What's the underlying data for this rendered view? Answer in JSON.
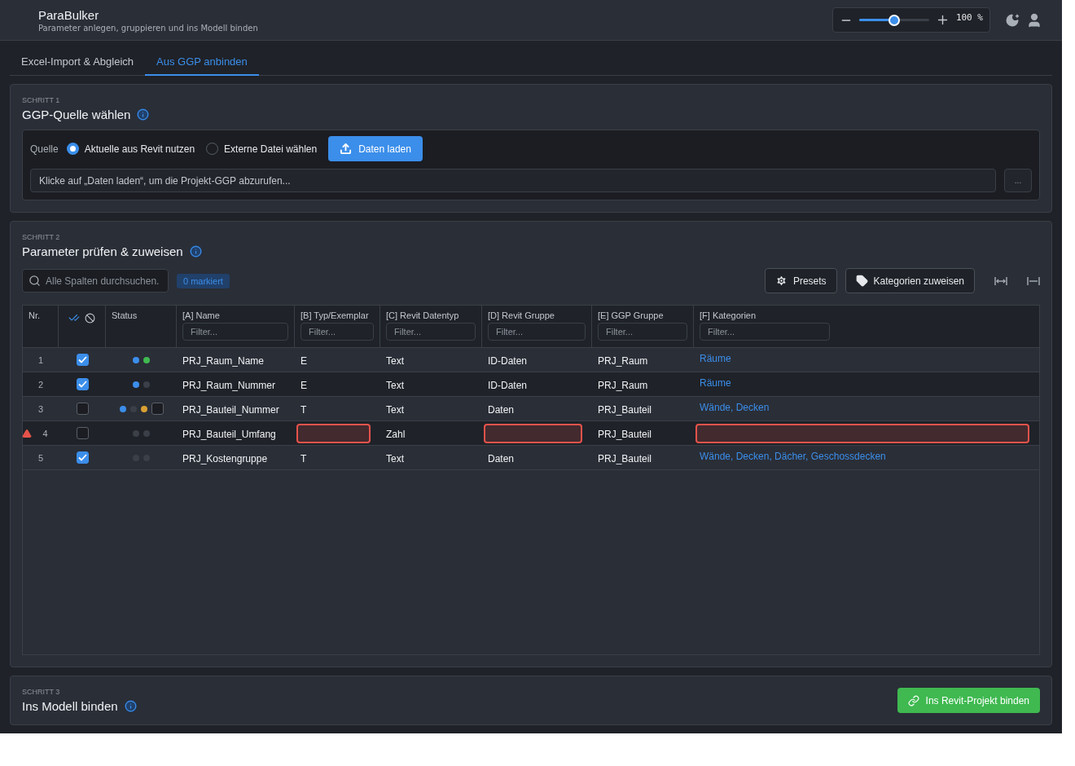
{
  "app": {
    "title": "ParaBulker",
    "subtitle": "Parameter anlegen, gruppieren und ins Modell binden"
  },
  "zoom": {
    "level": 0.5,
    "reading": "100 %"
  },
  "tabs": [
    {
      "label": "Excel-Import & Abgleich",
      "selected": false
    },
    {
      "label": "Aus GGP anbinden",
      "selected": true
    }
  ],
  "step1": {
    "step": "SCHRITT 1",
    "title": "GGP-Quelle wählen",
    "source_label": "Quelle",
    "options": [
      {
        "label": "Aktuelle aus Revit nutzen",
        "selected": true
      },
      {
        "label": "Externe Datei wählen",
        "selected": false
      }
    ],
    "load_button": "Daten laden",
    "path_placeholder": "Klicke auf „Daten laden“, um die Projekt-GGP abzurufen...",
    "browse_button": "..."
  },
  "step2": {
    "step": "SCHRITT 2",
    "title": "Parameter prüfen & zuweisen",
    "search_placeholder": "Alle Spalten durchsuchen.",
    "marked_badge": "0 markiert",
    "presets_button": "Presets",
    "categories_button": "Kategorien zuweisen",
    "table": {
      "nr_header": "Nr.",
      "status_header": "Status",
      "columns": [
        {
          "label": "[A] Name",
          "kind": "text",
          "placeholder": "Filter..."
        },
        {
          "label": "[B] Typ/Exemplar",
          "kind": "text",
          "placeholder": "Filter..."
        },
        {
          "label": "[C] Revit Datentyp",
          "kind": "text",
          "placeholder": "Filter..."
        },
        {
          "label": "[D] Revit Gruppe",
          "kind": "text",
          "placeholder": "Filter..."
        },
        {
          "label": "[E] GGP Gruppe",
          "kind": "text",
          "placeholder": "Filter..."
        },
        {
          "label": "[F] Kategorien",
          "kind": "link",
          "placeholder": "Filter..."
        }
      ],
      "rows": [
        {
          "nr": "1",
          "checked": true,
          "warning": false,
          "status": [
            {
              "kind": "dot",
              "color": "#3b8eea"
            },
            {
              "kind": "dot",
              "color": "#3fb950"
            }
          ],
          "cells": [
            {
              "text": "PRJ_Raum_Name",
              "error": false
            },
            {
              "text": "E",
              "error": false
            },
            {
              "text": "Text",
              "error": false
            },
            {
              "text": "ID-Daten",
              "error": false
            },
            {
              "text": "PRJ_Raum",
              "error": false
            },
            {
              "text": "Räume",
              "error": false
            }
          ]
        },
        {
          "nr": "2",
          "checked": true,
          "warning": false,
          "status": [
            {
              "kind": "dot",
              "color": "#3b8eea"
            },
            {
              "kind": "dot",
              "color": "#3a3f48"
            }
          ],
          "cells": [
            {
              "text": "PRJ_Raum_Nummer",
              "error": false
            },
            {
              "text": "E",
              "error": false
            },
            {
              "text": "Text",
              "error": false
            },
            {
              "text": "ID-Daten",
              "error": false
            },
            {
              "text": "PRJ_Raum",
              "error": false
            },
            {
              "text": "Räume",
              "error": false
            }
          ]
        },
        {
          "nr": "3",
          "checked": false,
          "warning": false,
          "status": [
            {
              "kind": "dot",
              "color": "#3b8eea"
            },
            {
              "kind": "dot",
              "color": "#3a3f48"
            },
            {
              "kind": "dot",
              "color": "#d9a032"
            },
            {
              "kind": "box",
              "checked": false
            }
          ],
          "cells": [
            {
              "text": "PRJ_Bauteil_Nummer",
              "error": false
            },
            {
              "text": "T",
              "error": false
            },
            {
              "text": "Text",
              "error": false
            },
            {
              "text": "Daten",
              "error": false
            },
            {
              "text": "PRJ_Bauteil",
              "error": false
            },
            {
              "text": "Wände, Decken",
              "error": false
            }
          ]
        },
        {
          "nr": "4",
          "checked": false,
          "warning": true,
          "status": [
            {
              "kind": "dot",
              "color": "#3a3f48"
            },
            {
              "kind": "dot",
              "color": "#3a3f48"
            }
          ],
          "cells": [
            {
              "text": "PRJ_Bauteil_Umfang",
              "error": false
            },
            {
              "error": true
            },
            {
              "text": "Zahl",
              "error": false
            },
            {
              "error": true
            },
            {
              "text": "PRJ_Bauteil",
              "error": false
            },
            {
              "error": true
            }
          ]
        },
        {
          "nr": "5",
          "checked": true,
          "warning": false,
          "status": [
            {
              "kind": "dot",
              "color": "#3a3f48"
            },
            {
              "kind": "dot",
              "color": "#3a3f48"
            }
          ],
          "cells": [
            {
              "text": "PRJ_Kostengruppe",
              "error": false
            },
            {
              "text": "T",
              "error": false
            },
            {
              "text": "Text",
              "error": false
            },
            {
              "text": "Daten",
              "error": false
            },
            {
              "text": "PRJ_Bauteil",
              "error": false
            },
            {
              "text": "Wände, Decken, Dächer, Geschossdecken",
              "error": false
            }
          ]
        }
      ]
    }
  },
  "step3": {
    "step": "SCHRITT 3",
    "title": "Ins Modell binden",
    "bind_button": "Ins Revit-Projekt binden"
  }
}
